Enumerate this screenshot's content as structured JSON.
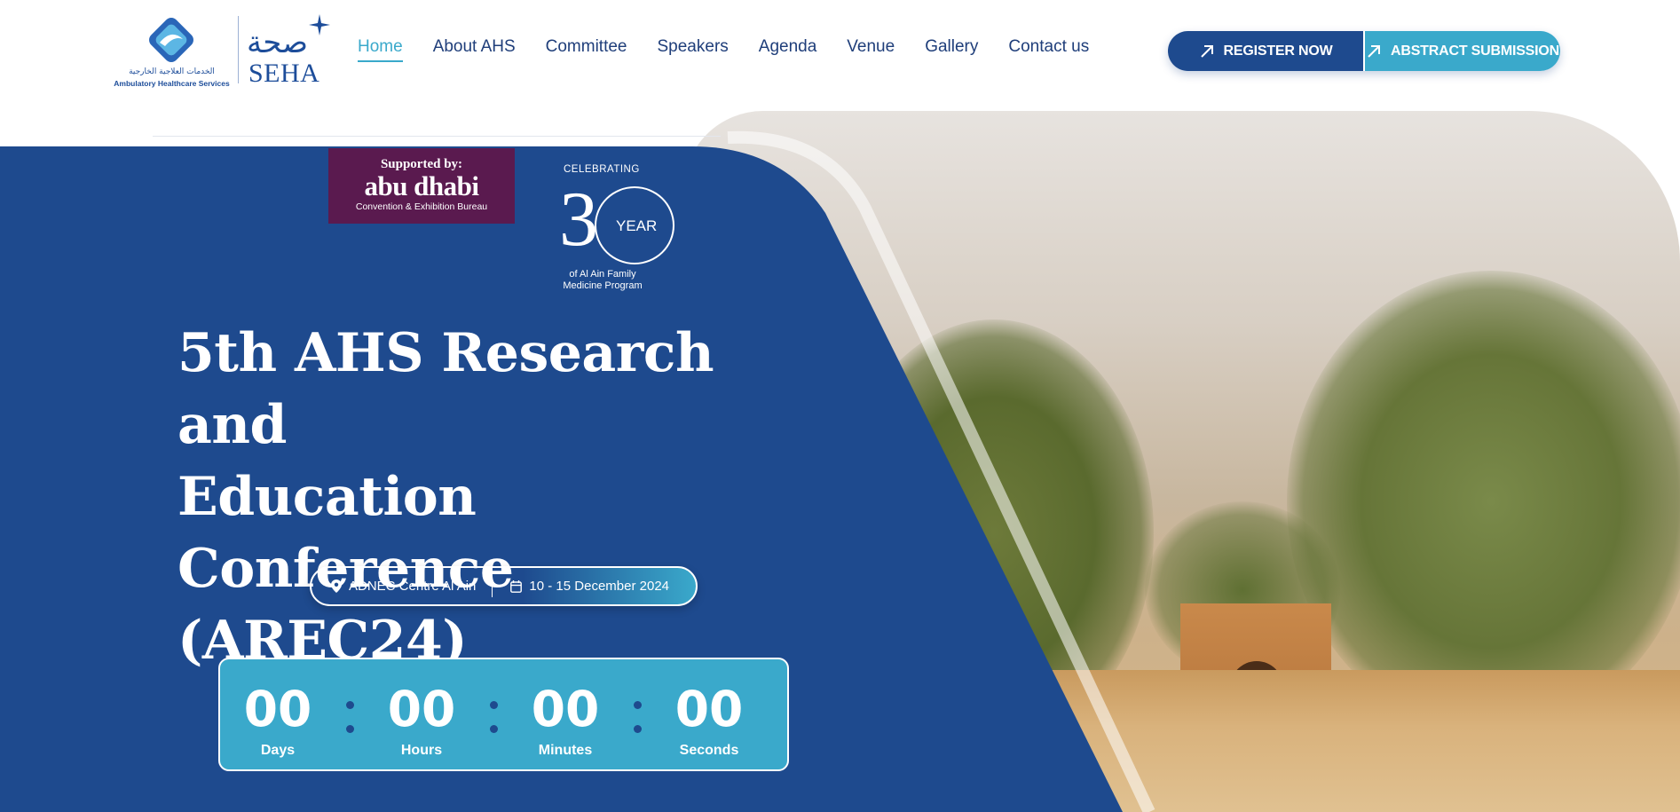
{
  "header": {
    "logo_ahs": {
      "arabic": "الخدمات العلاجية الخارجية",
      "english": "Ambulatory Healthcare Services"
    },
    "logo_seha": {
      "arabic": "صحة",
      "english": "SEHA"
    },
    "nav": [
      {
        "label": "Home",
        "active": true
      },
      {
        "label": "About AHS",
        "active": false
      },
      {
        "label": "Committee",
        "active": false
      },
      {
        "label": "Speakers",
        "active": false
      },
      {
        "label": "Agenda",
        "active": false
      },
      {
        "label": "Venue",
        "active": false
      },
      {
        "label": "Gallery",
        "active": false
      },
      {
        "label": "Contact us",
        "active": false
      }
    ],
    "register_label": "REGISTER NOW",
    "abstract_label": "ABSTRACT SUBMISSION"
  },
  "hero": {
    "supported": {
      "label": "Supported by:",
      "name": "abu dhabi",
      "sub": "Convention & Exhibition Bureau"
    },
    "celebrating": {
      "top": "CELEBRATING",
      "number": "3",
      "year": "YEAR",
      "sub_line1": "of Al Ain Family",
      "sub_line2": "Medicine Program"
    },
    "title_line1": "5th AHS Research and",
    "title_line2": "Education Conference",
    "title_line3": "(AREC24)",
    "location": "ADNEC Centre Al Ain",
    "dates": "10 - 15 December 2024"
  },
  "countdown": {
    "days": {
      "value": "00",
      "label": "Days"
    },
    "hours": {
      "value": "00",
      "label": "Hours"
    },
    "minutes": {
      "value": "00",
      "label": "Minutes"
    },
    "seconds": {
      "value": "00",
      "label": "Seconds"
    }
  },
  "colors": {
    "primary_blue": "#1e4a8e",
    "accent_cyan": "#3aa9cb",
    "plum": "#5a1a4f"
  },
  "icons": {
    "location": "map-pin-icon",
    "date": "calendar-icon",
    "cta": "arrow-up-right-icon"
  }
}
